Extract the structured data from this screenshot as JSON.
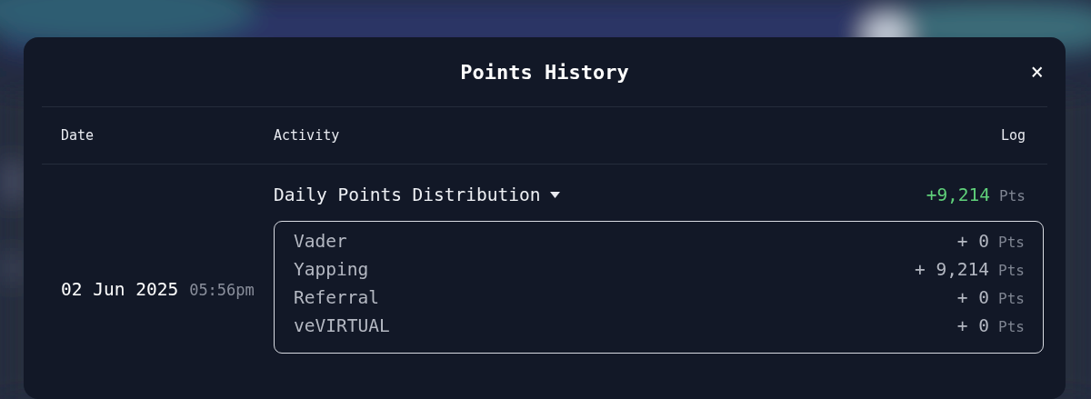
{
  "dialog": {
    "title": "Points History",
    "close": "×"
  },
  "columns": [
    "Date",
    "Activity",
    "Log"
  ],
  "entries": [
    {
      "date": "02 Jun 2025",
      "time": "05:56pm",
      "activity": "Daily Points Distribution",
      "expanded": true,
      "amount": "+9,214",
      "unit": "Pts",
      "details": [
        {
          "label": "Vader",
          "amount": "+ 0",
          "unit": "Pts"
        },
        {
          "label": "Yapping",
          "amount": "+ 9,214",
          "unit": "Pts"
        },
        {
          "label": "Referral",
          "amount": "+ 0",
          "unit": "Pts"
        },
        {
          "label": "veVIRTUAL",
          "amount": "+ 0",
          "unit": "Pts"
        }
      ]
    }
  ]
}
